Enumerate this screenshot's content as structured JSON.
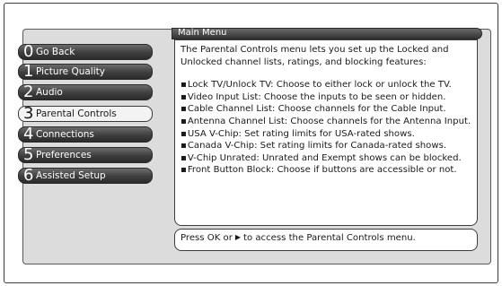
{
  "sidebar": {
    "items": [
      {
        "number": "0",
        "label": "Go Back",
        "selected": false
      },
      {
        "number": "1",
        "label": "Picture Quality",
        "selected": false
      },
      {
        "number": "2",
        "label": "Audio",
        "selected": false
      },
      {
        "number": "3",
        "label": "Parental Controls",
        "selected": true
      },
      {
        "number": "4",
        "label": "Connections",
        "selected": false
      },
      {
        "number": "5",
        "label": "Preferences",
        "selected": false
      },
      {
        "number": "6",
        "label": "Assisted Setup",
        "selected": false
      }
    ]
  },
  "main": {
    "title": "Main Menu",
    "intro": "The Parental Controls menu lets you set up the Locked and Unlocked channel lists, ratings, and blocking features:",
    "bullet_char": "▪",
    "bullets": [
      "Lock TV/Unlock TV: Choose to either lock or unlock the TV.",
      "Video Input List: Choose the inputs to be seen or hidden.",
      "Cable Channel List: Choose channels for the Cable Input.",
      "Antenna Channel List: Choose channels for the Antenna Input.",
      "USA V-Chip: Set rating limits for USA-rated shows.",
      "Canada V-Chip: Set rating limits for Canada-rated shows.",
      "V-Chip Unrated: Unrated and Exempt shows can be blocked.",
      "Front Button Block: Choose if buttons are accessible or not."
    ]
  },
  "footer": {
    "prefix": "Press OK or",
    "arrow_icon": "right-arrow-icon",
    "suffix": "to access the Parental Controls menu."
  },
  "colors": {
    "button_dark": "#3e3e3e",
    "button_selected": "#f3f3f3",
    "panel_bg": "#dcdcdc"
  }
}
